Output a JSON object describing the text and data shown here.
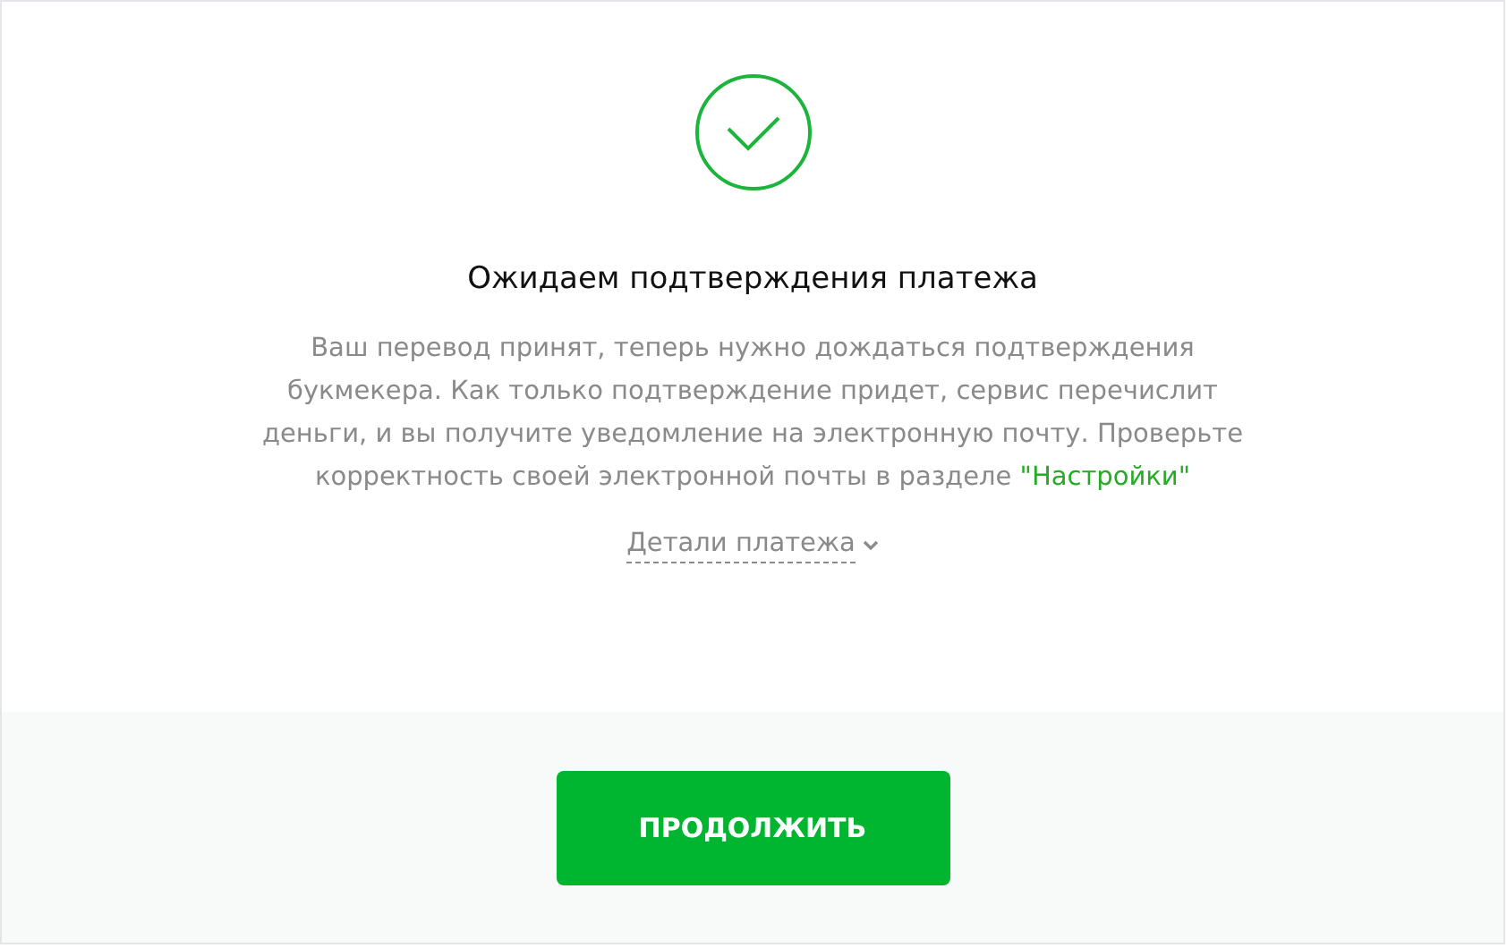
{
  "title": "Ожидаем подтверждения платежа",
  "message": "Ваш перевод принят, теперь нужно дождаться подтверждения букмекера. Как только подтверждение придет, сервис перечислит деньги, и вы получите уведомление на электронную почту. Проверьте корректность своей электронной почты в разделе",
  "settings_link": "\"Настройки\"",
  "details": {
    "label": "Детали платежа",
    "expanded": false
  },
  "button": "ПРОДОЛЖИТЬ"
}
